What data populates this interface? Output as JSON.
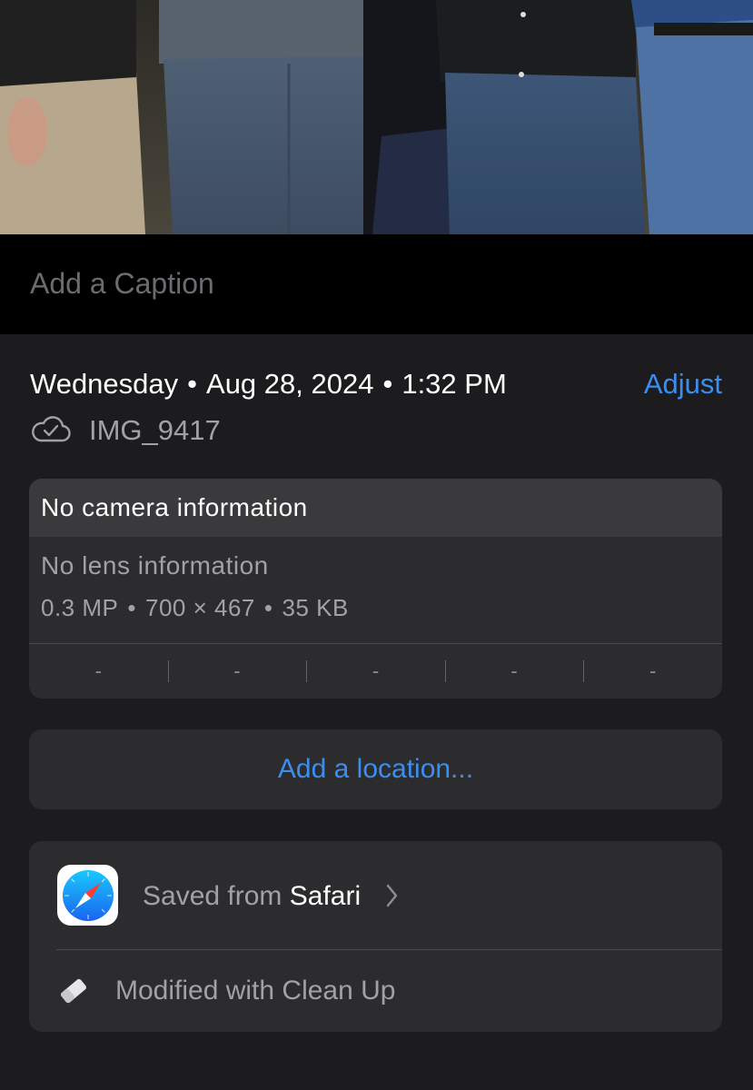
{
  "caption": {
    "placeholder": "Add a Caption"
  },
  "info": {
    "day": "Wednesday",
    "date": "Aug 28, 2024",
    "time": "1:32 PM",
    "separator": "•",
    "adjust_label": "Adjust",
    "filename": "IMG_9417",
    "cloud_icon": "cloud-check-icon"
  },
  "camera": {
    "title": "No camera information",
    "lens": "No lens information",
    "megapixels": "0.3 MP",
    "dimensions": "700 × 467",
    "filesize": "35 KB",
    "exif": [
      "-",
      "-",
      "-",
      "-",
      "-"
    ]
  },
  "location": {
    "label": "Add a location..."
  },
  "source": {
    "saved_prefix": "Saved from",
    "app_name": "Safari",
    "app_icon": "safari-icon",
    "modified_label": "Modified with Clean Up",
    "modified_icon": "eraser-icon"
  },
  "colors": {
    "accent": "#3b8ef0",
    "background": "#1c1c1e",
    "card": "#2c2c2e",
    "secondary_text": "#a1a1a6"
  }
}
